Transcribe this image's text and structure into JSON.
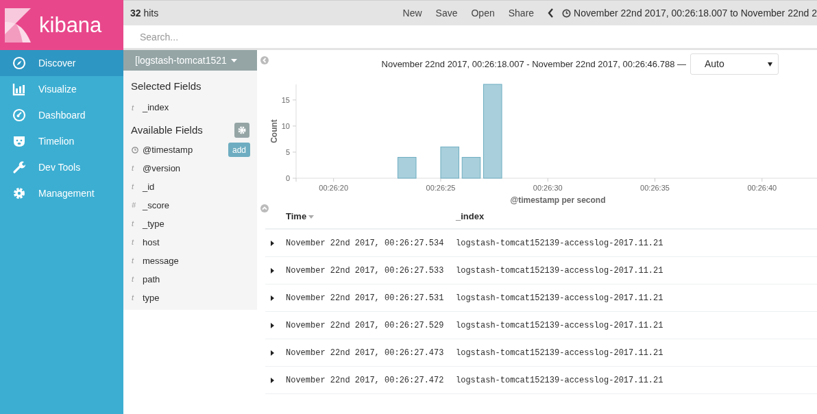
{
  "logo": {
    "text": "kibana"
  },
  "nav": [
    {
      "label": "Discover",
      "selected": true
    },
    {
      "label": "Visualize",
      "selected": false
    },
    {
      "label": "Dashboard",
      "selected": false
    },
    {
      "label": "Timelion",
      "selected": false
    },
    {
      "label": "Dev Tools",
      "selected": false
    },
    {
      "label": "Management",
      "selected": false
    }
  ],
  "top_bar": {
    "hits_count": "32",
    "hits_label": "hits",
    "actions": [
      "New",
      "Save",
      "Open",
      "Share"
    ],
    "time_range": "November 22nd 2017, 00:26:18.007 to November 22nd 2"
  },
  "search": {
    "placeholder": "Search..."
  },
  "index_pattern": "[logstash-tomcat1521",
  "selected_fields_title": "Selected Fields",
  "selected_fields": [
    {
      "type": "t",
      "name": "_index"
    }
  ],
  "available_fields_title": "Available Fields",
  "available_fields": [
    {
      "kind": "date",
      "name": "@timestamp",
      "add": "add"
    },
    {
      "type": "t",
      "name": "@version"
    },
    {
      "type": "t",
      "name": "_id"
    },
    {
      "type": "#",
      "name": "_score"
    },
    {
      "type": "t",
      "name": "_type"
    },
    {
      "type": "t",
      "name": "host"
    },
    {
      "type": "t",
      "name": "message"
    },
    {
      "type": "t",
      "name": "path"
    },
    {
      "type": "t",
      "name": "type"
    }
  ],
  "chart_header": {
    "range": "November 22nd 2017, 00:26:18.007 - November 22nd 2017, 00:26:46.788 —",
    "interval": "Auto"
  },
  "chart_data": {
    "type": "bar",
    "xlabel": "@timestamp per second",
    "ylabel": "Count",
    "categories": [
      null,
      null,
      "00:26:20",
      null,
      null,
      null,
      null,
      "00:26:25",
      null,
      null,
      null,
      null,
      "00:26:30",
      null,
      null,
      null,
      null,
      "00:26:35",
      null,
      null,
      null,
      null,
      "00:26:40",
      null,
      null
    ],
    "values": [
      null,
      null,
      null,
      null,
      null,
      4,
      null,
      6,
      4,
      18,
      null,
      null,
      null,
      null,
      null,
      null,
      null,
      null,
      null,
      null,
      null,
      null,
      null,
      null,
      null
    ],
    "ylim": [
      0,
      18
    ],
    "yticks": [
      0,
      5,
      10,
      15
    ]
  },
  "table": {
    "columns": [
      "Time",
      "_index"
    ],
    "rows": [
      {
        "time": "November 22nd 2017, 00:26:27.534",
        "index": "logstash-tomcat152139-accesslog-2017.11.21"
      },
      {
        "time": "November 22nd 2017, 00:26:27.533",
        "index": "logstash-tomcat152139-accesslog-2017.11.21"
      },
      {
        "time": "November 22nd 2017, 00:26:27.531",
        "index": "logstash-tomcat152139-accesslog-2017.11.21"
      },
      {
        "time": "November 22nd 2017, 00:26:27.529",
        "index": "logstash-tomcat152139-accesslog-2017.11.21"
      },
      {
        "time": "November 22nd 2017, 00:26:27.473",
        "index": "logstash-tomcat152139-accesslog-2017.11.21"
      },
      {
        "time": "November 22nd 2017, 00:26:27.472",
        "index": "logstash-tomcat152139-accesslog-2017.11.21"
      }
    ]
  }
}
